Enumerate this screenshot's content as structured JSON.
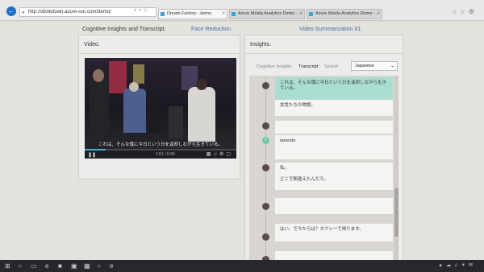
{
  "browser": {
    "address": "http://vbinkdown.azure-ssn.com/demo/",
    "tabs": [
      {
        "label": "Dream Factory - demo"
      },
      {
        "label": "Azure Meida Analytics Demo - ..."
      },
      {
        "label": "Azure Meida Analytics Demo - ..."
      }
    ]
  },
  "nav": {
    "cognitive": "Cognitive Insights and Transcript.",
    "face": "Face Reduction.",
    "summary": "Video Summarization #1."
  },
  "video_panel": {
    "title": "Video.",
    "subtitle": "これは、そんな僕に今日という日を返却しながら生きている。",
    "time": "1:51 / 6:56",
    "progress": 0.14
  },
  "insights_panel": {
    "title": "Insights.",
    "tabs": [
      {
        "label": "Cognitive Insights"
      },
      {
        "label": "Transcript"
      },
      {
        "label": "Search"
      }
    ],
    "language": "Japanese",
    "entries": [
      {
        "text": "これは、そんな僕に今日という日を返却しながら生きている。",
        "highlight": true
      },
      {
        "text": "女性たちの物語。",
        "highlight": false
      },
      {
        "text": "",
        "highlight": false
      },
      {
        "text": "episode",
        "highlight": false
      },
      {
        "text": "私。",
        "highlight": false
      },
      {
        "text": "どこで間違えたんだろ。",
        "highlight": false
      },
      {
        "text": "",
        "highlight": false
      },
      {
        "text": "はい、で今からは？タクシーで帰ります。",
        "highlight": false
      }
    ]
  },
  "icons": {
    "back": "back-arrow-icon",
    "play": "play-icon",
    "chevron": "chevron-down-icon"
  }
}
